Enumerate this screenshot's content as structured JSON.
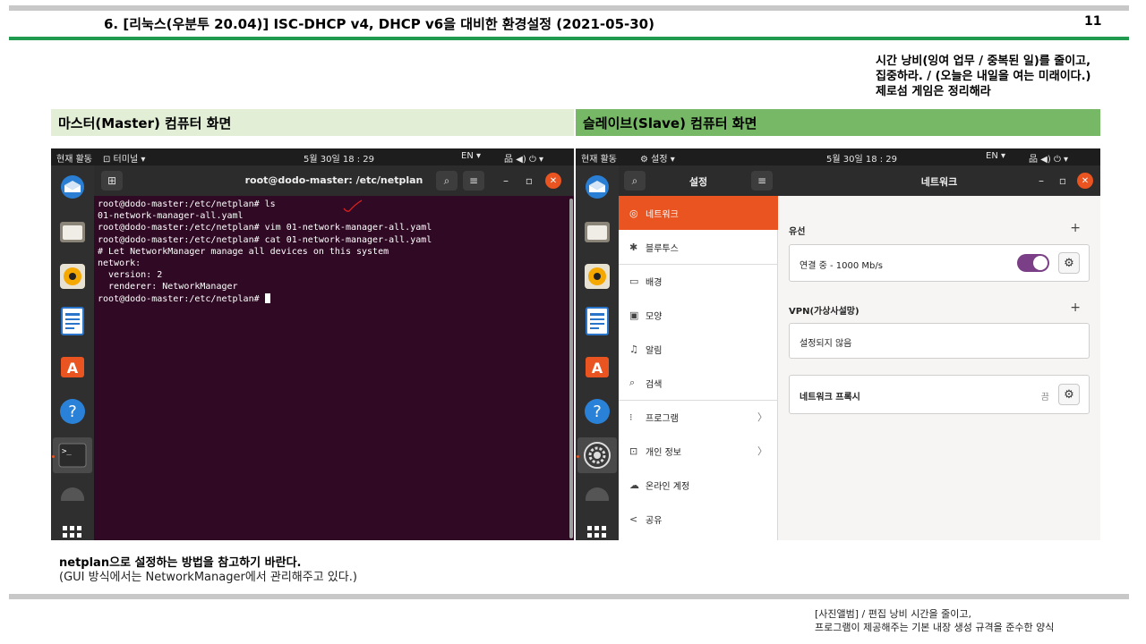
{
  "document": {
    "title": "6. [리눅스(우분투 20.04)] ISC-DHCP v4, DHCP v6을 대비한 환경설정 (2021-05-30)",
    "page_number": "11",
    "note_lines": [
      "시간 낭비(잉여 업무 / 중복된 일)를 줄이고,",
      "집중하라. / (오늘은 내일을 여는 미래이다.)",
      "제로섬 게임은 정리해라"
    ],
    "master_heading": "마스터(Master) 컴퓨터 화면",
    "slave_heading": "슬레이브(Slave) 컴퓨터 화면",
    "caption_bold": "netplan으로 설정하는 방법을 참고하기 바란다.",
    "caption_note": "(GUI 방식에서는 NetworkManager에서 관리해주고 있다.)",
    "footer_lines": [
      "[사진앨범] / 편집 낭비 시간을 줄이고,",
      "프로그램이 제공해주는 기본 내장 생성 규격을 준수한 양식"
    ]
  },
  "master": {
    "activities": "현재 활동",
    "app_menu": "⊡ 터미널 ▾",
    "clock": "5월 30일  18 : 29",
    "lang": "EN ▾",
    "tray": "品  ◀)  ⏻  ▾",
    "terminal_title": "root@dodo-master: /etc/netplan",
    "terminal_lines": [
      "root@dodo-master:/etc/netplan# ls",
      "01-network-manager-all.yaml",
      "root@dodo-master:/etc/netplan# vim 01-network-manager-all.yaml",
      "root@dodo-master:/etc/netplan# cat 01-network-manager-all.yaml",
      "# Let NetworkManager manage all devices on this system",
      "network:",
      "  version: 2",
      "  renderer: NetworkManager"
    ],
    "prompt": "root@dodo-master:/etc/netplan# "
  },
  "slave": {
    "activities": "현재 활동",
    "app_menu": "⚙ 설정 ▾",
    "clock": "5월 30일  18 : 29",
    "lang": "EN ▾",
    "tray": "品  ◀)  ⏻  ▾",
    "sidebar_title": "설정",
    "page_title": "네트워크",
    "sidebar_items": [
      {
        "icon": "◎",
        "label": "네트워크"
      },
      {
        "icon": "✱",
        "label": "블루투스"
      },
      {
        "icon": "▭",
        "label": "배경"
      },
      {
        "icon": "▣",
        "label": "모양"
      },
      {
        "icon": "♫",
        "label": "알림"
      },
      {
        "icon": "⌕",
        "label": "검색"
      },
      {
        "icon": "⁝",
        "label": "프로그램"
      },
      {
        "icon": "⊡",
        "label": "개인 정보"
      },
      {
        "icon": "☁",
        "label": "온라인 계정"
      },
      {
        "icon": "<",
        "label": "공유"
      }
    ],
    "wired_label": "유선",
    "wired_status": "연결 중 - 1000 Mb/s",
    "wired_toggle_on": true,
    "vpn_label": "VPN(가상사설망)",
    "vpn_status": "설정되지 않음",
    "proxy_label": "네트워크 프록시",
    "proxy_state": "끔"
  }
}
